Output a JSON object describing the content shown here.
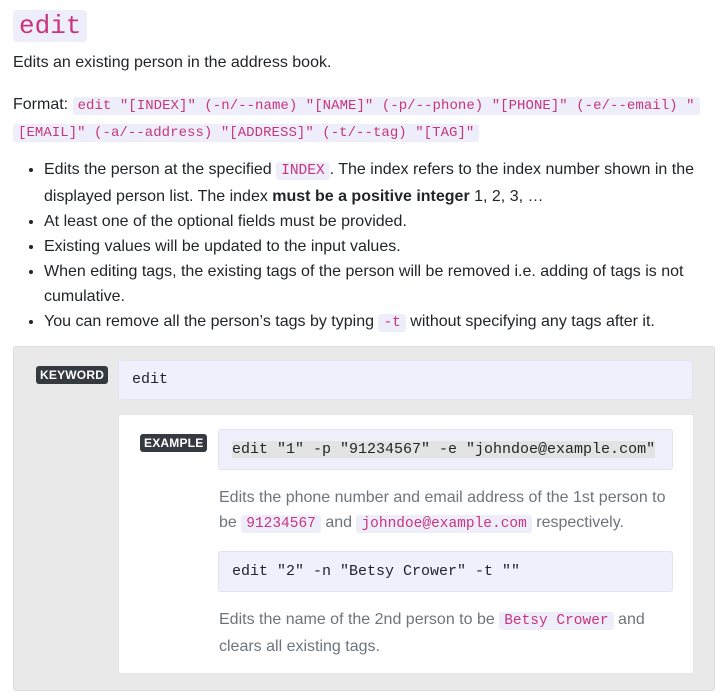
{
  "title": "edit",
  "description": "Edits an existing person in the address book.",
  "format": {
    "label": "Format:",
    "code": "edit \"[INDEX]\" (-n/--name) \"[NAME]\" (-p/--phone) \"[PHONE]\" (-e/--email) \"[EMAIL]\" (-a/--address) \"[ADDRESS]\" (-t/--tag) \"[TAG]\""
  },
  "bullets": {
    "b1_part1": "Edits the person at the specified ",
    "b1_code": "INDEX",
    "b1_part2": ". The index refers to the index number shown in the displayed person list. The index ",
    "b1_bold": "must be a positive integer",
    "b1_part3": " 1, 2, 3, …",
    "b2": "At least one of the optional fields must be provided.",
    "b3": "Existing values will be updated to the input values.",
    "b4": "When editing tags, the existing tags of the person will be removed i.e. adding of tags is not cumulative.",
    "b5_part1": "You can remove all the person’s tags by typing ",
    "b5_code": "-t",
    "b5_part2": " without specifying any tags after it."
  },
  "keyword": {
    "badge": "KEYWORD",
    "value": "edit"
  },
  "example": {
    "badge": "EXAMPLE",
    "cmd1": "edit \"1\" -p \"91234567\" -e \"johndoe@example.com\"",
    "desc1_part1": "Edits the phone number and email address of the 1st person to be ",
    "desc1_code1": "91234567",
    "desc1_part2": " and ",
    "desc1_code2": "johndoe@example.com",
    "desc1_part3": " respectively.",
    "cmd2": "edit \"2\" -n \"Betsy Crower\" -t \"\"",
    "desc2_part1": "Edits the name of the 2nd person to be ",
    "desc2_code": "Betsy Crower",
    "desc2_part2": " and clears all existing tags."
  }
}
